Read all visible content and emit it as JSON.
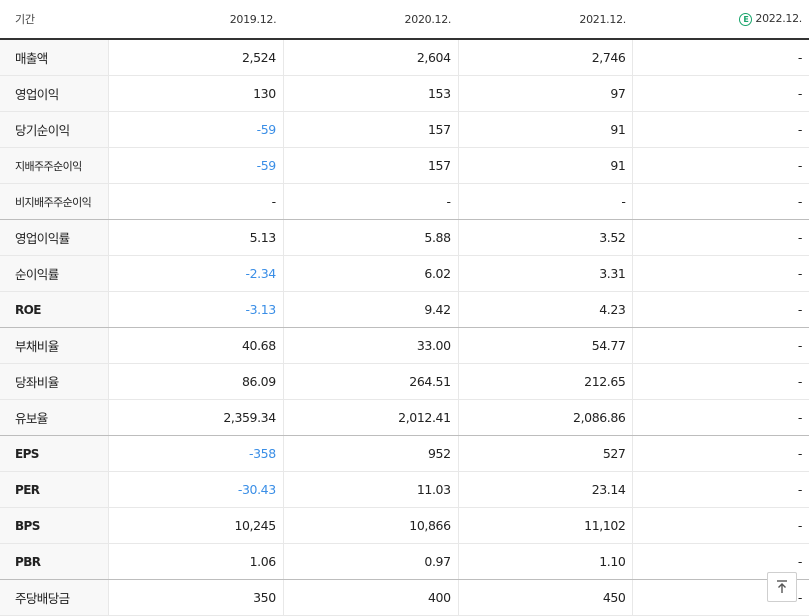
{
  "header": {
    "period_label": "기간",
    "columns": [
      "2019.12.",
      "2020.12.",
      "2021.12.",
      "2022.12."
    ],
    "estimate_icon": "E"
  },
  "rows": [
    {
      "label": "매출액",
      "values": [
        "2,524",
        "2,604",
        "2,746",
        "-"
      ]
    },
    {
      "label": "영업이익",
      "values": [
        "130",
        "153",
        "97",
        "-"
      ]
    },
    {
      "label": "당기순이익",
      "values": [
        "-59",
        "157",
        "91",
        "-"
      ]
    },
    {
      "label": "지배주주순이익",
      "values": [
        "-59",
        "157",
        "91",
        "-"
      ]
    },
    {
      "label": "비지배주주순이익",
      "values": [
        "-",
        "-",
        "-",
        "-"
      ]
    },
    {
      "label": "영업이익률",
      "values": [
        "5.13",
        "5.88",
        "3.52",
        "-"
      ]
    },
    {
      "label": "순이익률",
      "values": [
        "-2.34",
        "6.02",
        "3.31",
        "-"
      ]
    },
    {
      "label": "ROE",
      "values": [
        "-3.13",
        "9.42",
        "4.23",
        "-"
      ]
    },
    {
      "label": "부채비율",
      "values": [
        "40.68",
        "33.00",
        "54.77",
        "-"
      ]
    },
    {
      "label": "당좌비율",
      "values": [
        "86.09",
        "264.51",
        "212.65",
        "-"
      ]
    },
    {
      "label": "유보율",
      "values": [
        "2,359.34",
        "2,012.41",
        "2,086.86",
        "-"
      ]
    },
    {
      "label": "EPS",
      "values": [
        "-358",
        "952",
        "527",
        "-"
      ]
    },
    {
      "label": "PER",
      "values": [
        "-30.43",
        "11.03",
        "23.14",
        "-"
      ]
    },
    {
      "label": "BPS",
      "values": [
        "10,245",
        "10,866",
        "11,102",
        "-"
      ]
    },
    {
      "label": "PBR",
      "values": [
        "1.06",
        "0.97",
        "1.10",
        "-"
      ]
    },
    {
      "label": "주당배당금",
      "values": [
        "350",
        "400",
        "450",
        "-"
      ]
    }
  ],
  "colors": {
    "negative": "#3a8ee6",
    "estimate": "#1aa56c"
  },
  "scroll_top_button": {
    "icon": "arrow-up-to-top-icon"
  }
}
